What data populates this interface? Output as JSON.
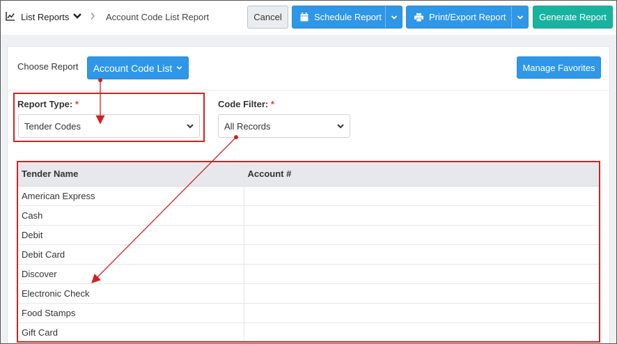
{
  "breadcrumb": {
    "root_label": "List Reports",
    "current": "Account Code List Report"
  },
  "toolbar": {
    "cancel_label": "Cancel",
    "schedule_label": "Schedule Report",
    "print_label": "Print/Export Report",
    "generate_label": "Generate Report"
  },
  "report_chooser": {
    "label": "Choose Report",
    "selected": "Account Code List",
    "favorites_label": "Manage Favorites"
  },
  "filters": {
    "report_type": {
      "label": "Report Type:",
      "required_mark": "*",
      "value": "Tender Codes"
    },
    "code_filter": {
      "label": "Code Filter:",
      "required_mark": "*",
      "value": "All Records"
    }
  },
  "table": {
    "columns": [
      "Tender Name",
      "Account #"
    ],
    "rows": [
      [
        "American Express",
        ""
      ],
      [
        "Cash",
        ""
      ],
      [
        "Debit",
        ""
      ],
      [
        "Debit Card",
        ""
      ],
      [
        "Discover",
        ""
      ],
      [
        "Electronic Check",
        ""
      ],
      [
        "Food Stamps",
        ""
      ],
      [
        "Gift Card",
        ""
      ]
    ]
  },
  "colors": {
    "primary": "#2e97e8",
    "generate": "#17b3a0",
    "annotation_red": "#d61f1f"
  },
  "icons": {
    "breadcrumb_root": "chart-line-icon",
    "schedule": "calendar-icon",
    "print": "printer-icon"
  }
}
